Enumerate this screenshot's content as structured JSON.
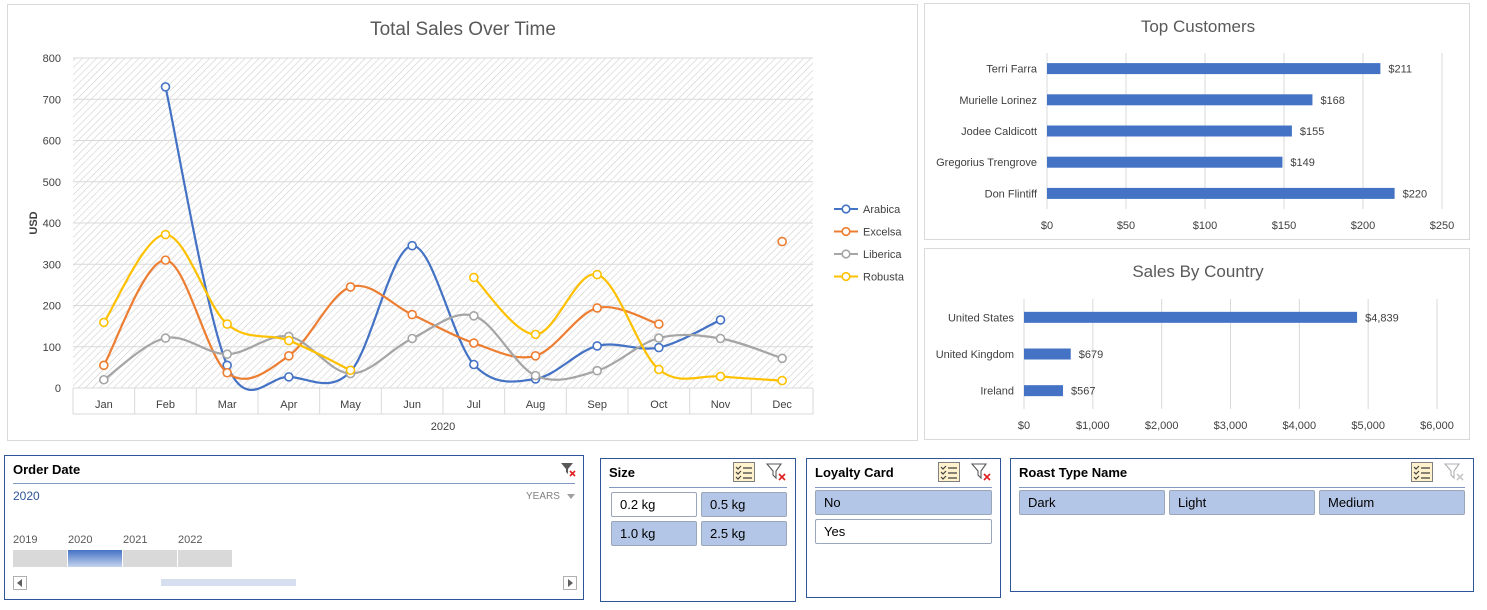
{
  "colors": {
    "arabica": "#4472c4",
    "excelsa": "#ed7d31",
    "liberica": "#a5a5a5",
    "robusta": "#ffc000",
    "bar": "#4472c4",
    "slicer_selected": "#b4c6e7",
    "slicer_border": "#2f5597"
  },
  "sales_chart": {
    "title": "Total Sales Over Time",
    "ylabel": "USD",
    "xgroup_label": "2020"
  },
  "customers_chart": {
    "title": "Top Customers"
  },
  "country_chart": {
    "title": "Sales By Country"
  },
  "chart_data": [
    {
      "type": "line",
      "title": "Total Sales Over Time",
      "ylabel": "USD",
      "xlabel": "2020",
      "ylim": [
        0,
        800
      ],
      "yticks": [
        0,
        100,
        200,
        300,
        400,
        500,
        600,
        700,
        800
      ],
      "categories": [
        "Jan",
        "Feb",
        "Mar",
        "Apr",
        "May",
        "Jun",
        "Jul",
        "Aug",
        "Sep",
        "Oct",
        "Nov",
        "Dec"
      ],
      "legend": "right",
      "series": [
        {
          "name": "Arabica",
          "color": "#4472c4",
          "values": [
            null,
            730,
            55,
            27,
            40,
            345,
            57,
            22,
            102,
            98,
            165,
            null
          ]
        },
        {
          "name": "Excelsa",
          "color": "#ed7d31",
          "values": [
            55,
            310,
            37,
            78,
            245,
            178,
            109,
            78,
            194,
            155,
            null,
            355
          ]
        },
        {
          "name": "Liberica",
          "color": "#a5a5a5",
          "values": [
            20,
            121,
            82,
            125,
            35,
            120,
            175,
            30,
            42,
            121,
            120,
            72
          ]
        },
        {
          "name": "Robusta",
          "color": "#ffc000",
          "values": [
            159,
            372,
            155,
            115,
            43,
            null,
            268,
            130,
            275,
            45,
            28,
            18
          ]
        }
      ]
    },
    {
      "type": "bar",
      "title": "Top Customers",
      "orientation": "horizontal",
      "categories": [
        "Terri Farra",
        "Murielle Lorinez",
        "Jodee Caldicott",
        "Gregorius Trengrove",
        "Don Flintiff"
      ],
      "values": [
        211,
        168,
        155,
        149,
        220
      ],
      "data_labels": [
        "$211",
        "$168",
        "$155",
        "$149",
        "$220"
      ],
      "xlim": [
        0,
        250
      ],
      "xticks": [
        "$0",
        "$50",
        "$100",
        "$150",
        "$200",
        "$250"
      ]
    },
    {
      "type": "bar",
      "title": "Sales By Country",
      "orientation": "horizontal",
      "categories": [
        "United States",
        "United Kingdom",
        "Ireland"
      ],
      "values": [
        4839,
        679,
        567
      ],
      "data_labels": [
        "$4,839",
        "$679",
        "$567"
      ],
      "xlim": [
        0,
        6000
      ],
      "xticks": [
        "$0",
        "$1,000",
        "$2,000",
        "$3,000",
        "$4,000",
        "$5,000",
        "$6,000"
      ]
    }
  ],
  "timeline": {
    "title": "Order Date",
    "selected_label": "2020",
    "level_label": "YEARS",
    "years": [
      "2019",
      "2020",
      "2021",
      "2022"
    ],
    "selected_index": 1
  },
  "size_slicer": {
    "title": "Size",
    "items": [
      {
        "label": "0.2 kg",
        "selected": false
      },
      {
        "label": "0.5 kg",
        "selected": true
      },
      {
        "label": "1.0 kg",
        "selected": true
      },
      {
        "label": "2.5 kg",
        "selected": true
      }
    ]
  },
  "loyalty_slicer": {
    "title": "Loyalty Card",
    "items": [
      {
        "label": "No",
        "selected": true
      },
      {
        "label": "Yes",
        "selected": false
      }
    ]
  },
  "roast_slicer": {
    "title": "Roast Type Name",
    "items": [
      {
        "label": "Dark",
        "selected": true
      },
      {
        "label": "Light",
        "selected": true
      },
      {
        "label": "Medium",
        "selected": true
      }
    ]
  },
  "icons": {
    "multiselect": "multi-select-icon",
    "clear_filter": "clear-filter-icon"
  }
}
